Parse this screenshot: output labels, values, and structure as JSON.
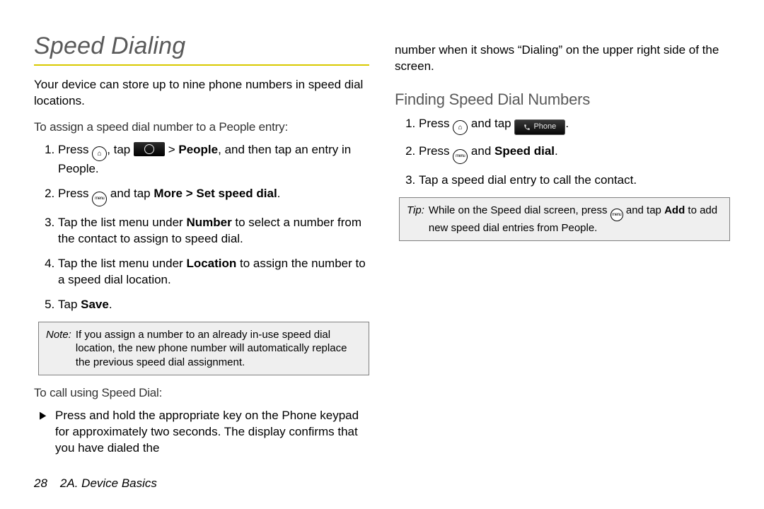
{
  "title": "Speed Dialing",
  "accent_color": "#d8c900",
  "left": {
    "intro": "Your device can store up to nine phone numbers in speed dial locations.",
    "assign_heading": "To assign a speed dial number to a People entry:",
    "steps": {
      "s1_a": "Press ",
      "s1_b": ", tap ",
      "s1_c": " > ",
      "s1_people": "People",
      "s1_d": ", and then tap an entry in People.",
      "s2_a": "Press ",
      "s2_b": " and tap ",
      "s2_more": "More > Set speed dial",
      "s2_c": ".",
      "s3_a": "Tap the list menu under ",
      "s3_number": "Number",
      "s3_b": " to select a number from the contact to assign to speed dial.",
      "s4_a": "Tap the list menu under ",
      "s4_location": "Location",
      "s4_b": " to assign the number to a speed dial location.",
      "s5_a": "Tap ",
      "s5_save": "Save",
      "s5_b": "."
    },
    "note_label": "Note:",
    "note_body": "If you assign a number to an already in-use speed dial location, the new phone number will automatically replace the previous speed dial assignment.",
    "call_heading": "To call using Speed Dial:",
    "bullet": "Press and hold the appropriate key on the Phone keypad for approximately two seconds. The display confirms that you have dialed the"
  },
  "right": {
    "continuation": "number when it shows “Dialing” on the upper right side of the screen.",
    "finding_heading": "Finding Speed Dial Numbers",
    "steps": {
      "s1_a": "Press ",
      "s1_b": " and tap ",
      "s1_c": ".",
      "s2_a": "Press ",
      "s2_b": " and ",
      "s2_speeddial": "Speed dial",
      "s2_c": ".",
      "s3": "Tap a speed dial entry to call the contact."
    },
    "tip_label": "Tip:",
    "tip_a": "While on the Speed dial screen, press ",
    "tip_b": " and tap ",
    "tip_add": "Add",
    "tip_c": " to add new speed dial entries from People."
  },
  "phone_button_label": "Phone",
  "footer": {
    "page_number": "28",
    "chapter": "2A. Device Basics"
  }
}
